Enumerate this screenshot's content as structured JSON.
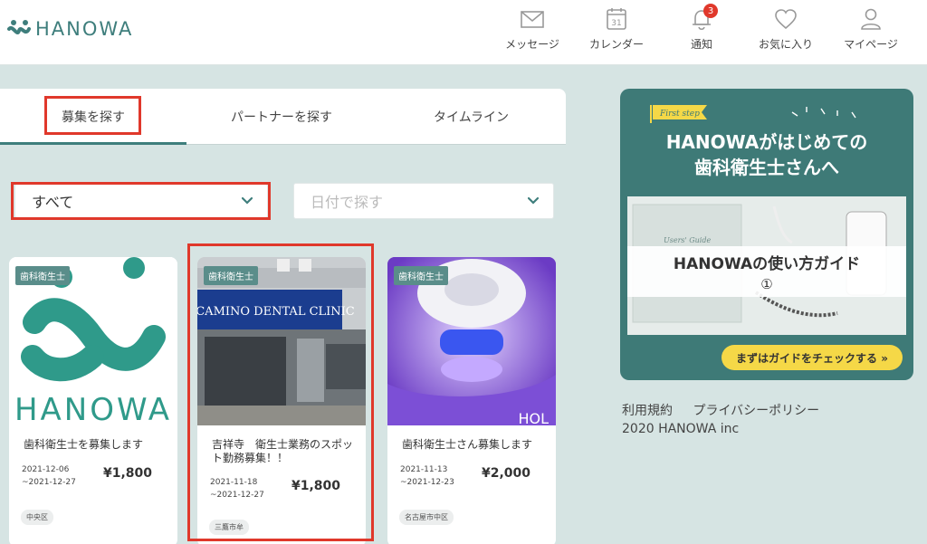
{
  "brand": {
    "name": "HANOWA"
  },
  "nav": [
    {
      "label": "メッセージ",
      "icon": "mail-icon"
    },
    {
      "label": "カレンダー",
      "icon": "calendar-icon",
      "day": "31"
    },
    {
      "label": "通知",
      "icon": "bell-icon",
      "badge": "3"
    },
    {
      "label": "お気に入り",
      "icon": "heart-icon"
    },
    {
      "label": "マイページ",
      "icon": "user-icon"
    }
  ],
  "tabs": [
    {
      "label": "募集を探す",
      "active": true
    },
    {
      "label": "パートナーを探す"
    },
    {
      "label": "タイムライン"
    }
  ],
  "filters": {
    "category": {
      "value": "すべて"
    },
    "date": {
      "placeholder": "日付で探す"
    }
  },
  "cards": [
    {
      "tag": "歯科衛生士",
      "image_text": "HANOWA",
      "title": "歯科衛生士を募集します",
      "dates": "2021-12-06\n~2021-12-27",
      "price": "¥1,800",
      "location": "中央区"
    },
    {
      "tag": "歯科衛生士",
      "image_text": "CAMINO DENTAL CLINIC",
      "title": "吉祥寺　衛生士業務のスポット勤務募集！！",
      "dates": "2021-11-18\n~2021-12-27",
      "price": "¥1,800",
      "location": "三鷹市牟"
    },
    {
      "tag": "歯科衛生士",
      "image_text": "HOL",
      "title": "歯科衛生士さん募集します",
      "dates": "2021-11-13\n~2021-12-23",
      "price": "¥2,000",
      "location": "名古屋市中区"
    }
  ],
  "banner": {
    "flag": "First step",
    "headline_1": "HANOWAがはじめての",
    "headline_2": "歯科衛生士さんへ",
    "guide_title": "HANOWAの使い方ガイド",
    "guide_number": "①",
    "book_label": "Users' Guide",
    "cta": "まずはガイドをチェックする »"
  },
  "footer": {
    "links": [
      "利用規約",
      "プライバシーポリシー"
    ],
    "copyright": "2020 HANOWA inc"
  },
  "colors": {
    "brand": "#3e7e7c",
    "highlight": "#e0382b",
    "cta": "#f5d847",
    "background": "#d6e4e3"
  }
}
